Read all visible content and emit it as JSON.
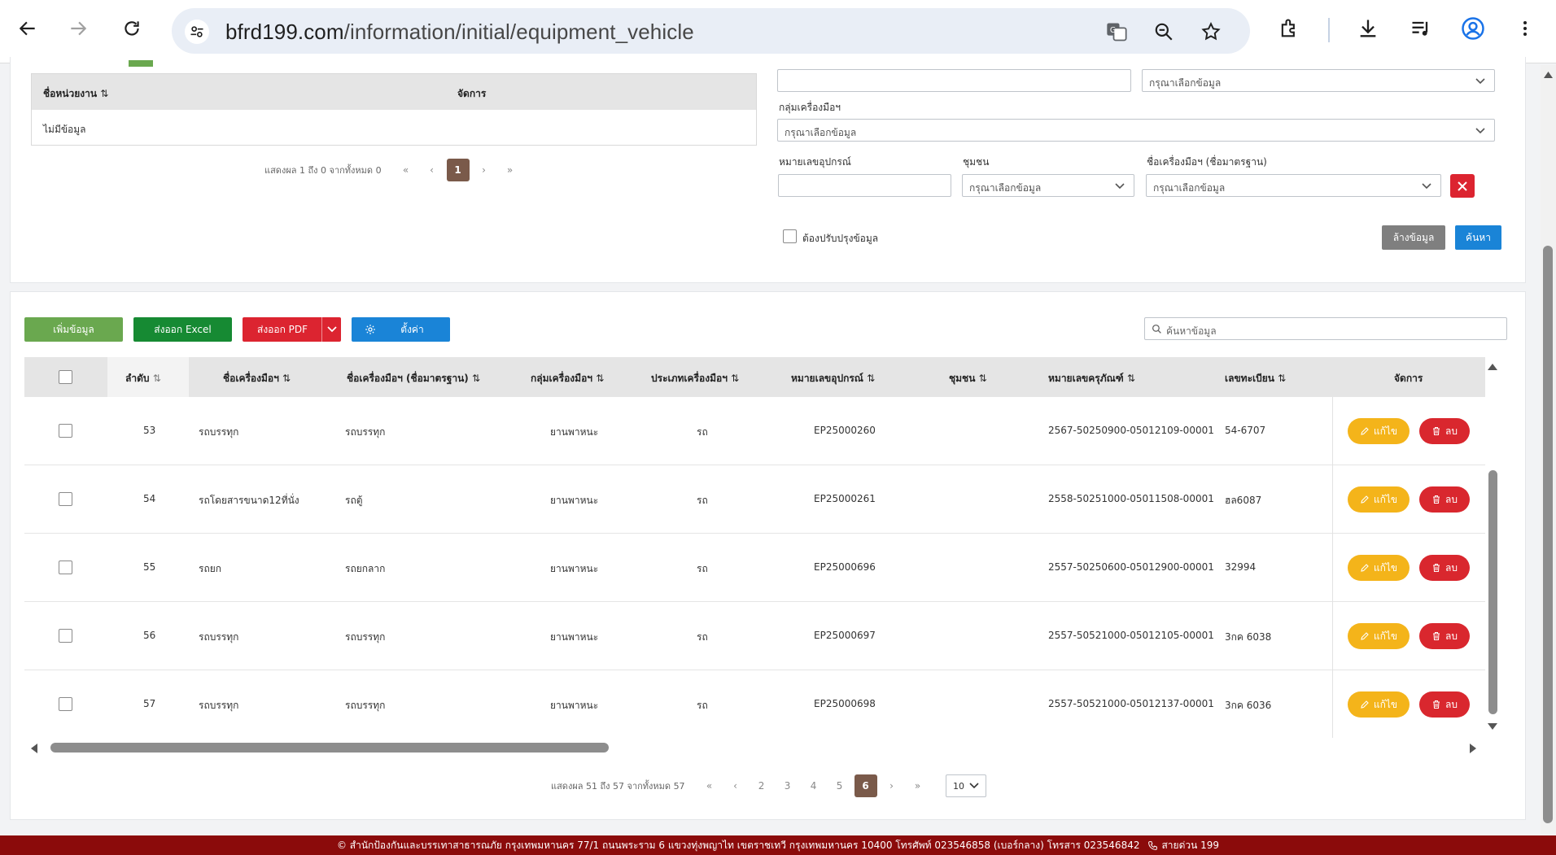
{
  "browser": {
    "url_domain": "bfrd199.com",
    "url_path": "/information/initial/equipment_vehicle"
  },
  "unit_table": {
    "col_name": "ชื่อหน่วยงาน",
    "col_manage": "จัดการ",
    "empty_text": "ไม่มีข้อมูล",
    "pager_info": "แสดงผล 1 ถึง 0 จากทั้งหมด 0",
    "current_page": "1"
  },
  "filters": {
    "select_placeholder": "กรุณาเลือกข้อมูล",
    "label_group": "กลุ่มเครื่องมือฯ",
    "label_device_no": "หมายเลขอุปกรณ์",
    "label_community": "ชุมชน",
    "label_std_name": "ชื่อเครื่องมือฯ (ชื่อมาตรฐาน)",
    "needs_update_label": "ต้องปรับปรุงข้อมูล",
    "clear_label": "ล้างข้อมูล",
    "search_label": "ค้นหา"
  },
  "toolbar": {
    "add_label": "เพิ่มข้อมูล",
    "excel_label": "ส่งออก Excel",
    "pdf_label": "ส่งออก PDF",
    "settings_label": "ตั้งค่า",
    "search_placeholder": "ค้นหาข้อมูล"
  },
  "table": {
    "columns": [
      "ลำดับ",
      "ชื่อเครื่องมือฯ",
      "ชื่อเครื่องมือฯ (ชื่อมาตรฐาน)",
      "กลุ่มเครื่องมือฯ",
      "ประเภทเครื่องมือฯ",
      "หมายเลขอุปกรณ์",
      "ชุมชน",
      "หมายเลขครุภัณฑ์",
      "เลขทะเบียน",
      "จัดการ"
    ],
    "edit_label": "แก้ไข",
    "delete_label": "ลบ",
    "rows": [
      {
        "no": "53",
        "name": "รถบรรทุก",
        "std_name": "รถบรรทุก",
        "group": "ยานพาหนะ",
        "type": "รถ",
        "device_no": "EP25000260",
        "community": "",
        "asset_no": "2567-50250900-05012109-00001",
        "plate": "54-6707"
      },
      {
        "no": "54",
        "name": "รถโดยสารขนาด12ที่นั่ง",
        "std_name": "รถตู้",
        "group": "ยานพาหนะ",
        "type": "รถ",
        "device_no": "EP25000261",
        "community": "",
        "asset_no": "2558-50251000-05011508-00001",
        "plate": "ฮล6087"
      },
      {
        "no": "55",
        "name": "รถยก",
        "std_name": "รถยกลาก",
        "group": "ยานพาหนะ",
        "type": "รถ",
        "device_no": "EP25000696",
        "community": "",
        "asset_no": "2557-50250600-05012900-00001",
        "plate": "32994"
      },
      {
        "no": "56",
        "name": "รถบรรทุก",
        "std_name": "รถบรรทุก",
        "group": "ยานพาหนะ",
        "type": "รถ",
        "device_no": "EP25000697",
        "community": "",
        "asset_no": "2557-50521000-05012105-00001",
        "plate": "3กค 6038"
      },
      {
        "no": "57",
        "name": "รถบรรทุก",
        "std_name": "รถบรรทุก",
        "group": "ยานพาหนะ",
        "type": "รถ",
        "device_no": "EP25000698",
        "community": "",
        "asset_no": "2557-50521000-05012137-00001",
        "plate": "3กค 6036"
      }
    ]
  },
  "pagination": {
    "info": "แสดงผล 51 ถึง 57 จากทั้งหมด 57",
    "pages": [
      "2",
      "3",
      "4",
      "5",
      "6"
    ],
    "current": "6",
    "page_size": "10"
  },
  "footer": {
    "text": "© สำนักป้องกันและบรรเทาสาธารณภัย กรุงเทพมหานคร 77/1 ถนนพระราม 6 แขวงทุ่งพญาไท เขตราชเทวี กรุงเทพมหานคร 10400 โทรศัพท์ 023546858 (เบอร์กลาง) โทรสาร 023546842",
    "hotline": "สายด่วน 199"
  },
  "colors": {
    "add": "#6aa84f",
    "excel": "#168a33",
    "pdf": "#dc2430",
    "settings": "#1a84d7",
    "edit": "#f4b41a",
    "delete": "#d9272e",
    "footer": "#8b0b0b",
    "page_active": "#7a5a4a"
  }
}
